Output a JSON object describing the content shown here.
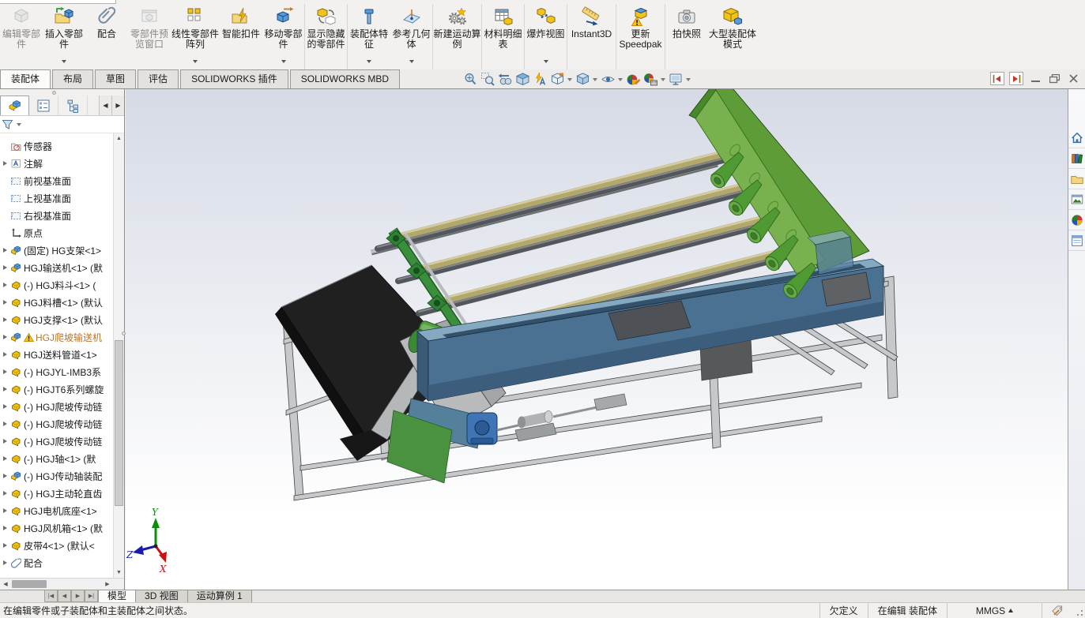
{
  "ribbon": {
    "buttons": [
      {
        "label": "编辑零部件",
        "icon": "edit-component-icon",
        "disabled": true
      },
      {
        "label": "插入零部件",
        "icon": "insert-component-icon",
        "dropdown": true
      },
      {
        "label": "配合",
        "icon": "mate-icon"
      },
      {
        "label": "零部件预览窗口",
        "icon": "component-preview-icon",
        "disabled": true
      },
      {
        "label": "线性零部件阵列",
        "icon": "linear-pattern-icon",
        "dropdown": true
      },
      {
        "label": "智能扣件",
        "icon": "smart-fasteners-icon"
      },
      {
        "label": "移动零部件",
        "icon": "move-component-icon",
        "dropdown": true
      },
      {
        "label": "显示隐藏的零部件",
        "icon": "show-hidden-components-icon"
      },
      {
        "label": "装配体特征",
        "icon": "assembly-features-icon",
        "dropdown": true
      },
      {
        "label": "参考几何体",
        "icon": "reference-geometry-icon",
        "dropdown": true
      },
      {
        "label": "新建运动算例",
        "icon": "motion-study-icon"
      },
      {
        "label": "材料明细表",
        "icon": "bom-icon"
      },
      {
        "label": "爆炸视图",
        "icon": "exploded-view-icon",
        "dropdown": true
      },
      {
        "label": "Instant3D",
        "icon": "instant3d-icon"
      },
      {
        "label": "更新 Speedpak",
        "icon": "update-speedpak-icon"
      },
      {
        "label": "拍快照",
        "icon": "snapshot-icon"
      },
      {
        "label": "大型装配体模式",
        "icon": "large-assembly-mode-icon"
      }
    ],
    "tabs": [
      {
        "label": "装配体",
        "active": true
      },
      {
        "label": "布局"
      },
      {
        "label": "草图"
      },
      {
        "label": "评估"
      },
      {
        "label": "SOLIDWORKS 插件"
      },
      {
        "label": "SOLIDWORKS MBD"
      }
    ]
  },
  "hud_icons": [
    "zoom-to-fit",
    "zoom-to-area",
    "previous-view",
    "section-view",
    "view-annotations",
    "view-orientation",
    "display-style",
    "hide-show-items",
    "edit-appearance",
    "apply-scene",
    "view-settings"
  ],
  "window_controls": [
    "pane-previous",
    "pane-next",
    "minimize",
    "restore",
    "close"
  ],
  "feature_tree": {
    "panel_tabs": [
      "featuremanager",
      "propertymanager",
      "configurationmanager"
    ],
    "filter_icon": "filter-funnel-icon",
    "items": [
      {
        "label": "传感器",
        "icon": "sensors-icon"
      },
      {
        "label": "注解",
        "icon": "annotations-icon",
        "expandable": true
      },
      {
        "label": "前视基准面",
        "icon": "plane-icon"
      },
      {
        "label": "上视基准面",
        "icon": "plane-icon"
      },
      {
        "label": "右视基准面",
        "icon": "plane-icon"
      },
      {
        "label": "原点",
        "icon": "origin-icon"
      },
      {
        "label": "(固定) HG支架<1>",
        "icon": "assembly-icon",
        "expandable": true
      },
      {
        "label": "HGJ输送机<1> (默",
        "icon": "assembly-icon",
        "expandable": true
      },
      {
        "label": "(-) HGJ料斗<1> (",
        "icon": "part-icon",
        "expandable": true
      },
      {
        "label": "HGJ料槽<1> (默认",
        "icon": "part-icon",
        "expandable": true
      },
      {
        "label": "HGJ支撑<1> (默认",
        "icon": "part-icon",
        "expandable": true
      },
      {
        "label": "HGJ爬坡输送机",
        "icon": "assembly-icon",
        "warning": true,
        "expandable": true
      },
      {
        "label": "HGJ送料管道<1>",
        "icon": "part-icon",
        "expandable": true
      },
      {
        "label": "(-) HGJYL-IMB3系",
        "icon": "part-icon",
        "expandable": true
      },
      {
        "label": "(-) HGJT6系列螺旋",
        "icon": "part-icon",
        "expandable": true
      },
      {
        "label": "(-) HGJ爬坡传动链",
        "icon": "part-icon",
        "expandable": true
      },
      {
        "label": "(-) HGJ爬坡传动链",
        "icon": "part-icon",
        "expandable": true
      },
      {
        "label": "(-) HGJ爬坡传动链",
        "icon": "part-icon",
        "expandable": true
      },
      {
        "label": "(-) HGJ轴<1> (默",
        "icon": "part-icon",
        "expandable": true
      },
      {
        "label": "(-) HGJ传动轴装配",
        "icon": "assembly-icon",
        "expandable": true
      },
      {
        "label": "(-) HGJ主动轮直齿",
        "icon": "part-icon",
        "expandable": true
      },
      {
        "label": "HGJ电机底座<1>",
        "icon": "part-icon",
        "expandable": true
      },
      {
        "label": "HGJ风机箱<1> (默",
        "icon": "part-icon",
        "expandable": true
      },
      {
        "label": "皮带4<1> (默认<",
        "icon": "part-icon",
        "expandable": true
      },
      {
        "label": "配合",
        "icon": "mates-icon",
        "expandable": true
      }
    ]
  },
  "task_pane_icons": [
    "resources-home",
    "design-library",
    "file-explorer",
    "view-palette",
    "appearances-scenes",
    "custom-properties"
  ],
  "bottom_tabs": {
    "tabs": [
      {
        "label": "模型",
        "active": true
      },
      {
        "label": "3D 视图"
      },
      {
        "label": "运动算例 1"
      }
    ]
  },
  "status_bar": {
    "message": "在编辑零件或子装配体和主装配体之间状态。",
    "constraint_status": "欠定义",
    "edit_mode": "在编辑 装配体",
    "units": "MMGS"
  },
  "viewport": {
    "triad": {
      "x_label": "X",
      "y_label": "Y",
      "z_label": "Z"
    },
    "colors": {
      "hopper_green": "#5d9c37",
      "trough_blue": "#4a7092",
      "roller_tan": "#b2a86e",
      "frame_gray": "#c6c8ca",
      "belt_black": "#202020",
      "motor_blue": "#3f74b5",
      "warning_text": "#b8762a"
    }
  }
}
